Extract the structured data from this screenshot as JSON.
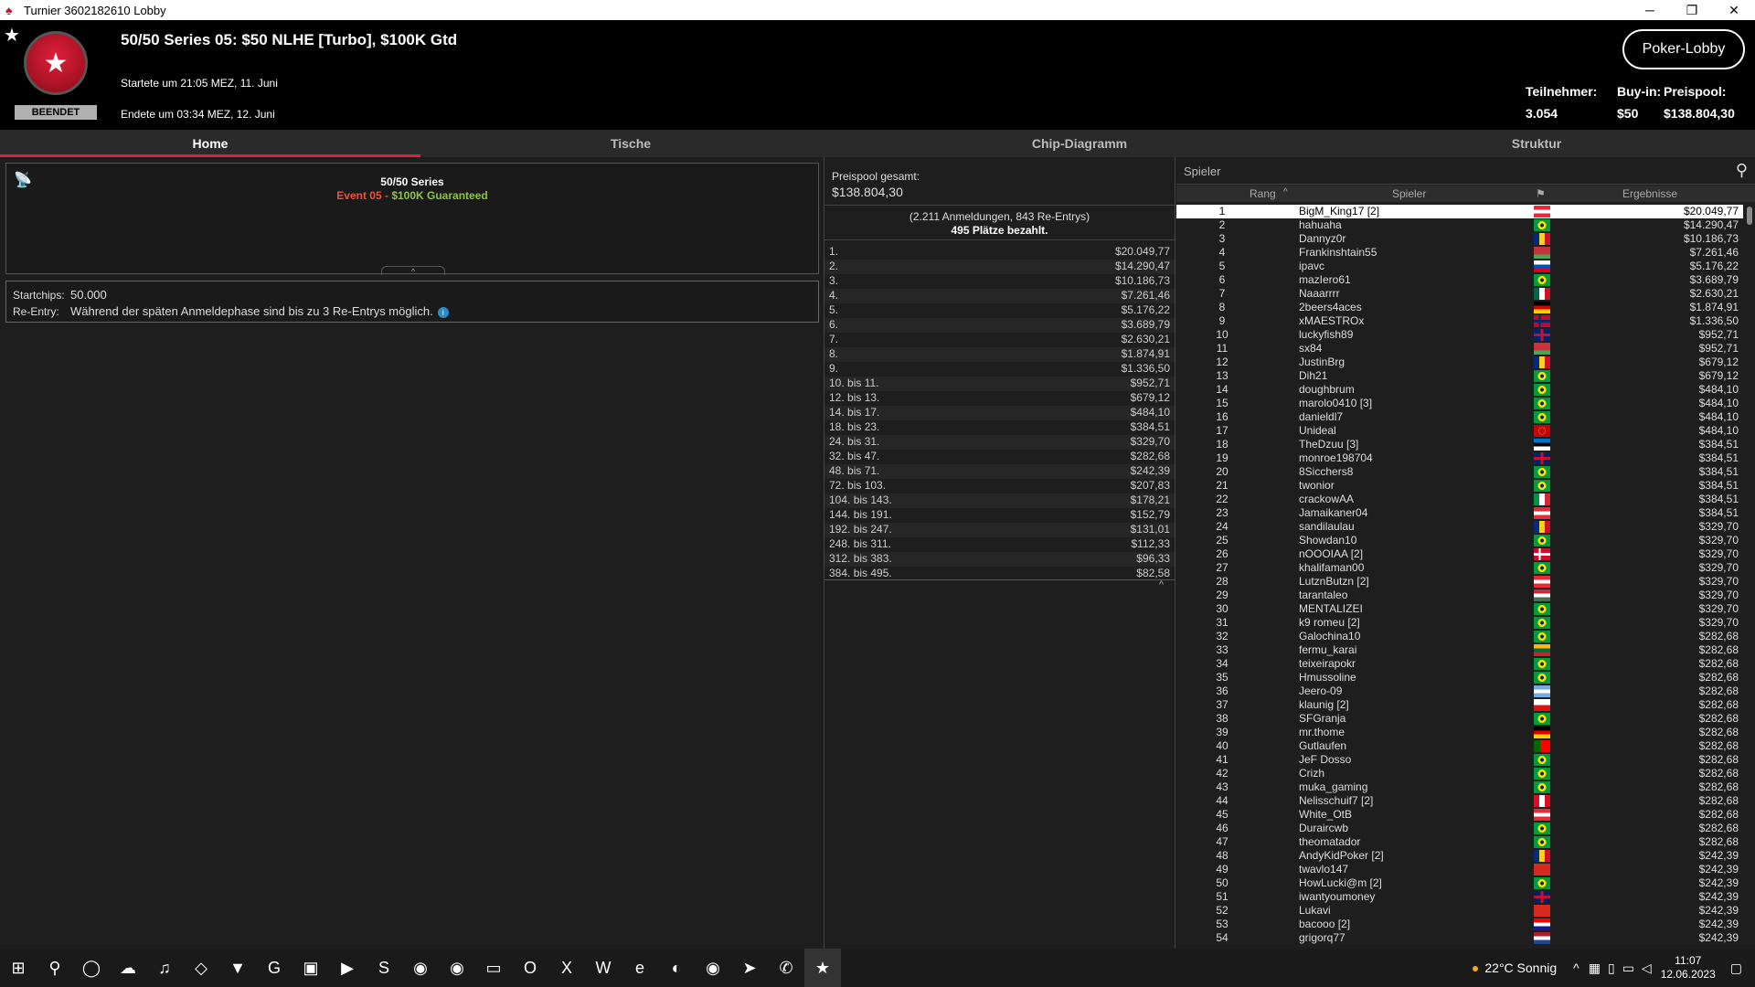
{
  "window": {
    "title": "Turnier 3602182610 Lobby"
  },
  "header": {
    "badge": "BEENDET",
    "title": "50/50 Series 05: $50 NLHE [Turbo], $100K Gtd",
    "start": "Startete um 21:05 MEZ, 11. Juni",
    "end": "Endete um 03:34 MEZ, 12. Juni",
    "lobby_button": "Poker-Lobby",
    "stats": [
      {
        "label": "Teilnehmer:",
        "value": "3.054"
      },
      {
        "label": "Buy-in:",
        "value": "$50"
      },
      {
        "label": "Preispool:",
        "value": "$138.804,30"
      }
    ]
  },
  "tabs": [
    "Home",
    "Tische",
    "Chip-Diagramm",
    "Struktur"
  ],
  "info": {
    "series": "50/50 Series",
    "event": "Event 05",
    "sep": " - ",
    "guarantee": "$100K Guaranteed",
    "startchips_label": "Startchips:",
    "startchips": "50.000",
    "reentry_label": "Re-Entry:",
    "reentry": "Während der späten Anmeldephase sind bis zu 3 Re-Entrys möglich."
  },
  "prizes": {
    "title": "Preispool gesamt:",
    "total": "$138.804,30",
    "entries": "(2.211 Anmeldungen, 843 Re-Entrys)",
    "paid": "495 Plätze bezahlt.",
    "rows": [
      [
        "1.",
        "$20.049,77"
      ],
      [
        "2.",
        "$14.290,47"
      ],
      [
        "3.",
        "$10.186,73"
      ],
      [
        "4.",
        "$7.261,46"
      ],
      [
        "5.",
        "$5.176,22"
      ],
      [
        "6.",
        "$3.689,79"
      ],
      [
        "7.",
        "$2.630,21"
      ],
      [
        "8.",
        "$1.874,91"
      ],
      [
        "9.",
        "$1.336,50"
      ],
      [
        "10. bis 11.",
        "$952,71"
      ],
      [
        "12. bis 13.",
        "$679,12"
      ],
      [
        "14. bis 17.",
        "$484,10"
      ],
      [
        "18. bis 23.",
        "$384,51"
      ],
      [
        "24. bis 31.",
        "$329,70"
      ],
      [
        "32. bis 47.",
        "$282,68"
      ],
      [
        "48. bis 71.",
        "$242,39"
      ],
      [
        "72. bis 103.",
        "$207,83"
      ],
      [
        "104. bis 143.",
        "$178,21"
      ],
      [
        "144. bis 191.",
        "$152,79"
      ],
      [
        "192. bis 247.",
        "$131,01"
      ],
      [
        "248. bis 311.",
        "$112,33"
      ],
      [
        "312. bis 383.",
        "$96,33"
      ],
      [
        "384. bis 495.",
        "$82,58"
      ]
    ]
  },
  "players": {
    "search_placeholder": "Spieler",
    "headers": {
      "rank": "Rang",
      "player": "Spieler",
      "result": "Ergebnisse"
    },
    "rows": [
      [
        "1",
        "BigM_King17 [2]",
        "$20.049,77",
        "AT"
      ],
      [
        "2",
        "hahuaha",
        "$14.290,47",
        "BR"
      ],
      [
        "3",
        "Dannyz0r",
        "$10.186,73",
        "RO"
      ],
      [
        "4",
        "Frankinshtain55",
        "$7.261,46",
        "BY"
      ],
      [
        "5",
        "ipavc",
        "$5.176,22",
        "SI"
      ],
      [
        "6",
        "mazIero61",
        "$3.689,79",
        "BR"
      ],
      [
        "7",
        "Naaarrrr",
        "$2.630,21",
        "MX"
      ],
      [
        "8",
        "2beers4aces",
        "$1.874,91",
        "DE"
      ],
      [
        "9",
        "xMAESTROx",
        "$1.336,50",
        "NO"
      ],
      [
        "10",
        "luckyfish89",
        "$952,71",
        "GB"
      ],
      [
        "11",
        "sx84",
        "$952,71",
        "BY"
      ],
      [
        "12",
        "JustinBrg",
        "$679,12",
        "RO"
      ],
      [
        "13",
        "Dih21",
        "$679,12",
        "BR"
      ],
      [
        "14",
        "doughbrum",
        "$484,10",
        "BR"
      ],
      [
        "15",
        "marolo0410 [3]",
        "$484,10",
        "BR"
      ],
      [
        "16",
        "danieldl7",
        "$484,10",
        "BR"
      ],
      [
        "17",
        "Unideal",
        "$484,10",
        "ME"
      ],
      [
        "18",
        "TheDzuu [3]",
        "$384,51",
        "EE"
      ],
      [
        "19",
        "monroe198704",
        "$384,51",
        "GB"
      ],
      [
        "20",
        "8Sicchers8",
        "$384,51",
        "BR"
      ],
      [
        "21",
        "twonior",
        "$384,51",
        "BR"
      ],
      [
        "22",
        "crackowAA",
        "$384,51",
        "IT"
      ],
      [
        "23",
        "Jamaikaner04",
        "$384,51",
        "AT"
      ],
      [
        "24",
        "sandilaulau",
        "$329,70",
        "RO"
      ],
      [
        "25",
        "Showdan10",
        "$329,70",
        "BR"
      ],
      [
        "26",
        "nOOOIAA [2]",
        "$329,70",
        "DK"
      ],
      [
        "27",
        "khalifaman00",
        "$329,70",
        "BR"
      ],
      [
        "28",
        "LutznButzn [2]",
        "$329,70",
        "AT"
      ],
      [
        "29",
        "tarantaleo",
        "$329,70",
        "HU"
      ],
      [
        "30",
        "MENTALIZEI",
        "$329,70",
        "BR"
      ],
      [
        "31",
        "k9 romeu [2]",
        "$329,70",
        "BR"
      ],
      [
        "32",
        "Galochina10",
        "$282,68",
        "BR"
      ],
      [
        "33",
        "fermu_karai",
        "$282,68",
        "LT"
      ],
      [
        "34",
        "teixeirapokr",
        "$282,68",
        "BR"
      ],
      [
        "35",
        "Hmussoline",
        "$282,68",
        "BR"
      ],
      [
        "36",
        "Jeero-09",
        "$282,68",
        "AR"
      ],
      [
        "37",
        "klaunig [2]",
        "$282,68",
        "CZ"
      ],
      [
        "38",
        "SFGranja",
        "$282,68",
        "BR"
      ],
      [
        "39",
        "mr.thome",
        "$282,68",
        "DE"
      ],
      [
        "40",
        "Gutlaufen",
        "$282,68",
        "PT"
      ],
      [
        "41",
        "JeF Dosso",
        "$282,68",
        "BR"
      ],
      [
        "42",
        "Crizh",
        "$282,68",
        "BR"
      ],
      [
        "43",
        "muka_gaming",
        "$282,68",
        "BR"
      ],
      [
        "44",
        "Nelisschuif7 [2]",
        "$282,68",
        "PE"
      ],
      [
        "45",
        "White_OtB",
        "$282,68",
        "AT"
      ],
      [
        "46",
        "Duraircwb",
        "$282,68",
        "BR"
      ],
      [
        "47",
        "theomatador",
        "$282,68",
        "BR"
      ],
      [
        "48",
        "AndyKidPoker [2]",
        "$242,39",
        "RO"
      ],
      [
        "49",
        "twavlo147",
        "$242,39",
        "CH"
      ],
      [
        "50",
        "HowLucki@m [2]",
        "$242,39",
        "BR"
      ],
      [
        "51",
        "iwantyoumoney",
        "$242,39",
        "GB"
      ],
      [
        "52",
        "Lukavi",
        "$242,39",
        "CH"
      ],
      [
        "53",
        "bacooo [2]",
        "$242,39",
        "HR"
      ],
      [
        "54",
        "grigorq77",
        "$242,39",
        "NL"
      ]
    ]
  },
  "taskbar": {
    "weather": "22°C Sonnig",
    "time": "11:07",
    "date": "12.06.2023"
  },
  "colors": {
    "accent": "#e0203a",
    "event_orange": "#e8553a",
    "guarantee_green": "#8fc04a"
  }
}
